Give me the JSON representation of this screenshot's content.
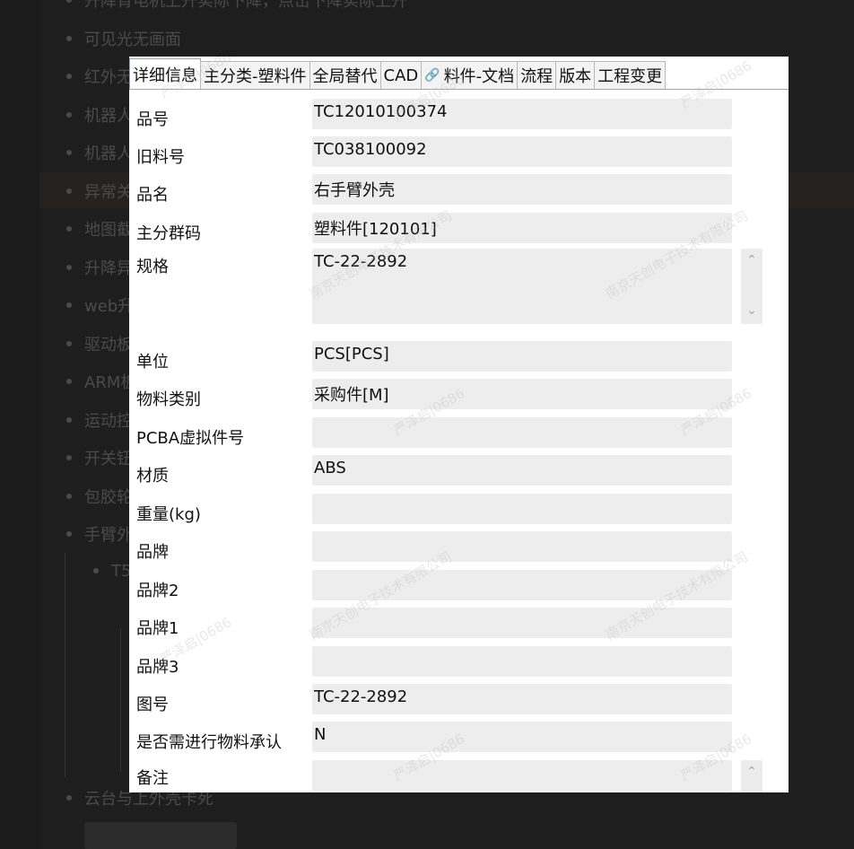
{
  "background": {
    "items": [
      "升降背电机上升实际下降，点击下降实际上升",
      "可见光无画面",
      "红外无",
      "机器人",
      "机器人",
      "异常关",
      "地图截",
      "升降异",
      "web升",
      "驱动板",
      "ARM板",
      "运动控",
      "开关钮",
      "包胶轮",
      "手臂外"
    ],
    "sub_item": "T5",
    "last_item": "云台与上外壳卡死"
  },
  "tabs": [
    {
      "label": "详细信息",
      "active": true,
      "icon": ""
    },
    {
      "label": "主分类-塑料件",
      "active": false,
      "icon": ""
    },
    {
      "label": "全局替代",
      "active": false,
      "icon": ""
    },
    {
      "label": "CAD",
      "active": false,
      "icon": ""
    },
    {
      "label": "料件-文档",
      "active": false,
      "icon": "paperclip-icon"
    },
    {
      "label": "流程",
      "active": false,
      "icon": ""
    },
    {
      "label": "版本",
      "active": false,
      "icon": ""
    },
    {
      "label": "工程变更",
      "active": false,
      "icon": ""
    }
  ],
  "fields": [
    {
      "label": "品号",
      "value": "TC12010100374"
    },
    {
      "label": "旧料号",
      "value": "TC038100092"
    },
    {
      "label": "品名",
      "value": "右手臂外壳"
    },
    {
      "label": "主分群码",
      "value": "塑料件[120101]"
    },
    {
      "label": "规格",
      "value": "TC-22-2892"
    },
    {
      "label": "单位",
      "value": "PCS[PCS]"
    },
    {
      "label": "物料类别",
      "value": "采购件[M]"
    },
    {
      "label": "PCBA虚拟件号",
      "value": ""
    },
    {
      "label": "材质",
      "value": "ABS"
    },
    {
      "label": "重量(kg)",
      "value": ""
    },
    {
      "label": "品牌",
      "value": ""
    },
    {
      "label": "品牌2",
      "value": ""
    },
    {
      "label": "品牌1",
      "value": ""
    },
    {
      "label": "品牌3",
      "value": ""
    },
    {
      "label": "图号",
      "value": "TC-22-2892"
    },
    {
      "label": "是否需进行物料承认",
      "value": "N"
    },
    {
      "label": "备注",
      "value": ""
    }
  ],
  "watermarks": [
    "严泽启|0686",
    "南京天创电子技术有限公司"
  ]
}
